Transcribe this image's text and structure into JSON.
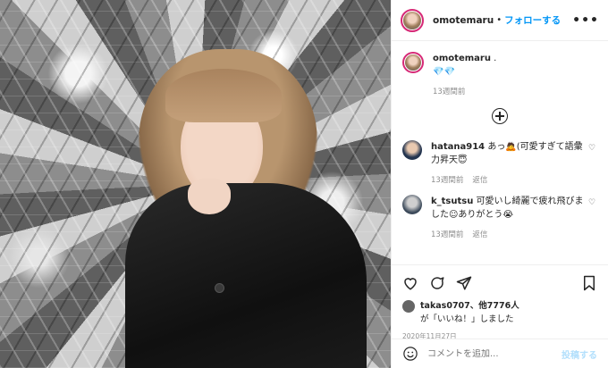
{
  "header": {
    "username": "omotemaru",
    "separator": "•",
    "follow_label": "フォローする",
    "more_label": "•••"
  },
  "caption": {
    "username": "omotemaru",
    "text": ".",
    "emoji": "💎💎",
    "time": "13週間前"
  },
  "comments": [
    {
      "username": "hatana914",
      "text": "あっ🙇(可愛すぎて語彙力昇天😇",
      "time": "13週間前",
      "reply_label": "返信"
    },
    {
      "username": "k_tsutsu",
      "text": "可愛いし綺麗で疲れ飛びました☺ありがとう😭",
      "time": "13週間前",
      "reply_label": "返信"
    }
  ],
  "likes": {
    "text_prefix": "takas0707",
    "text_suffix": "、他7776人",
    "text_line2": "が「いいね！」しました"
  },
  "date": "2020年11月27日",
  "comment_box": {
    "placeholder": "コメントを追加...",
    "post_label": "投稿する"
  },
  "colors": {
    "accent": "#0095f6",
    "post_disabled": "#b2dffc",
    "ring": "#d62976"
  },
  "icons": [
    "heart-icon",
    "comment-icon",
    "share-icon",
    "bookmark-icon",
    "emoji-icon",
    "more-icon",
    "load-more-icon"
  ]
}
